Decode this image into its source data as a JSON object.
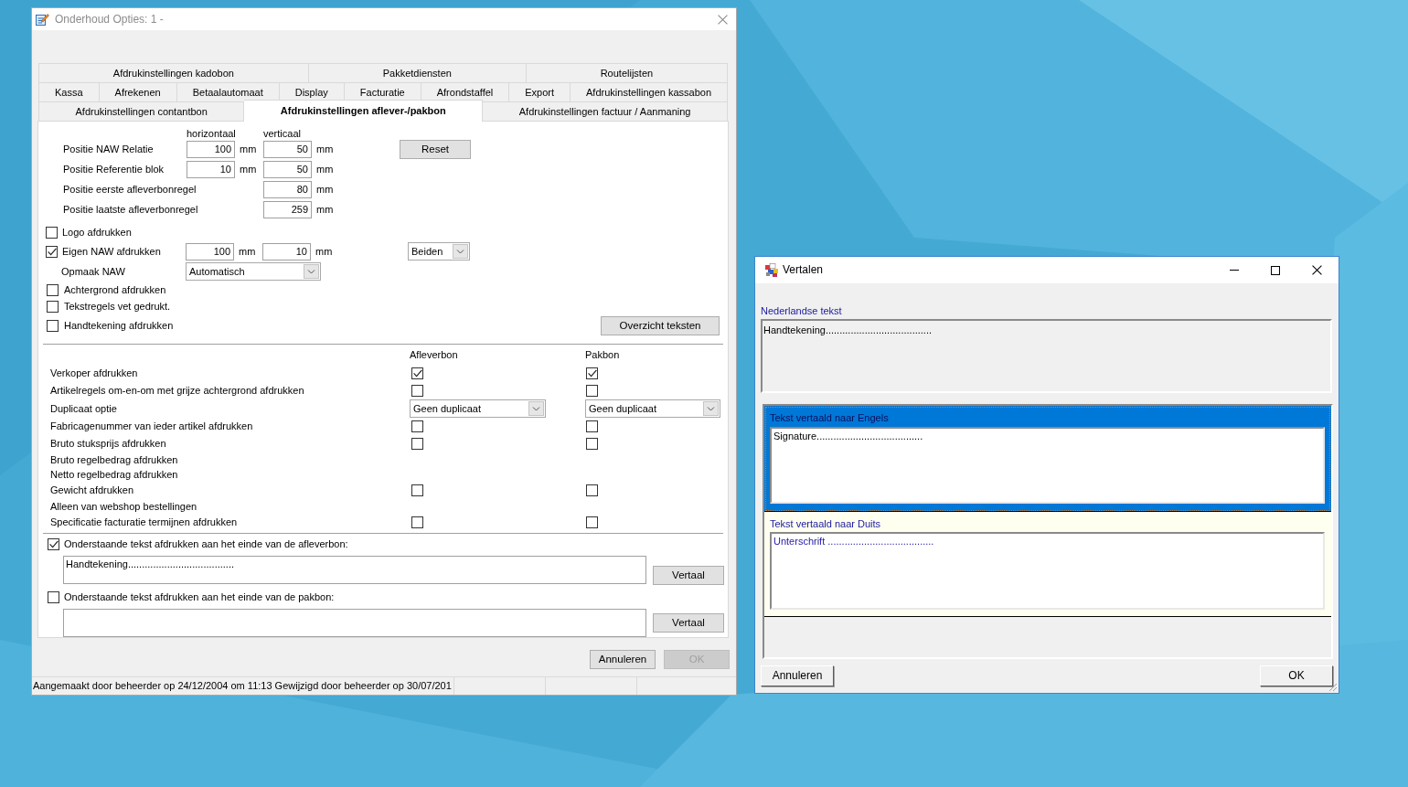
{
  "main_window": {
    "title": "Onderhoud Opties: 1 -",
    "active": false,
    "tab_rows": [
      [
        {
          "label": "Afdrukinstellingen kadobon",
          "selected": false
        },
        {
          "label": "Pakketdiensten",
          "selected": false
        },
        {
          "label": "Routelijsten",
          "selected": false
        }
      ],
      [
        {
          "label": "Kassa",
          "selected": false
        },
        {
          "label": "Afrekenen",
          "selected": false
        },
        {
          "label": "Betaalautomaat",
          "selected": false
        },
        {
          "label": "Display",
          "selected": false
        },
        {
          "label": "Facturatie",
          "selected": false
        },
        {
          "label": "Afrondstaffel",
          "selected": false
        },
        {
          "label": "Export",
          "selected": false
        },
        {
          "label": "Afdrukinstellingen kassabon",
          "selected": false
        }
      ],
      [
        {
          "label": "Afdrukinstellingen contantbon",
          "selected": false
        },
        {
          "label": "Afdrukinstellingen aflever-/pakbon",
          "selected": true
        },
        {
          "label": "Afdrukinstellingen factuur / Aanmaning",
          "selected": false
        }
      ]
    ],
    "position_headers": [
      "horizontaal",
      "verticaal"
    ],
    "position_rows": [
      {
        "label": "Positie NAW Relatie",
        "horizontal": {
          "value": "100",
          "unit": "mm"
        },
        "vertical": {
          "value": "50",
          "unit": "mm"
        }
      },
      {
        "label": "Positie Referentie blok",
        "horizontal": {
          "value": "10",
          "unit": "mm"
        },
        "vertical": {
          "value": "50",
          "unit": "mm"
        }
      },
      {
        "label": "Positie eerste afleverbonregel",
        "vertical": {
          "value": "80",
          "unit": "mm"
        }
      },
      {
        "label": "Positie laatste afleverbonregel",
        "vertical": {
          "value": "259",
          "unit": "mm"
        }
      }
    ],
    "reset_button": "Reset",
    "logo": {
      "label": "Logo afdrukken",
      "checked": false
    },
    "own_address": {
      "label": "Eigen NAW afdrukken",
      "checked": true,
      "horizontal": {
        "value": "100",
        "unit": "mm"
      },
      "vertical": {
        "value": "10",
        "unit": "mm"
      },
      "mode": "Beiden"
    },
    "address_layout": {
      "label": "Opmaak NAW",
      "value": "Automatisch"
    },
    "print_options": [
      {
        "label": "Achtergrond afdrukken",
        "checked": false
      },
      {
        "label": "Tekstregels vet gedrukt.",
        "checked": false
      },
      {
        "label": "Handtekening afdrukken",
        "checked": false
      }
    ],
    "overview_button": "Overzicht teksten",
    "document_options": {
      "columns": [
        "Afleverbon",
        "Pakbon"
      ],
      "rows": [
        {
          "label": "Verkoper afdrukken",
          "kind": "checkbox",
          "values": [
            {
              "checked": true
            },
            {
              "checked": true
            }
          ]
        },
        {
          "label": "Artikelregels om-en-om met grijze achtergrond afdrukken",
          "kind": "checkbox",
          "values": [
            {
              "checked": false
            },
            {
              "checked": false
            }
          ]
        },
        {
          "label": "Duplicaat optie",
          "kind": "select",
          "values": [
            {
              "value": "Geen duplicaat"
            },
            {
              "value": "Geen duplicaat"
            }
          ]
        },
        {
          "label": "Fabricagenummer van ieder artikel afdrukken",
          "kind": "checkbox",
          "values": [
            {
              "checked": false
            },
            {
              "checked": false
            }
          ]
        },
        {
          "label": "Bruto stuksprijs afdrukken",
          "kind": "checkbox",
          "values": [
            {
              "checked": false
            },
            {
              "checked": false
            }
          ]
        },
        {
          "label": "Bruto regelbedrag afdrukken",
          "kind": "text"
        },
        {
          "label": "Netto regelbedrag afdrukken",
          "kind": "text"
        },
        {
          "label": "Gewicht afdrukken",
          "kind": "checkbox",
          "values": [
            {
              "checked": false
            },
            {
              "checked": false
            }
          ]
        },
        {
          "label": "Alleen van webshop bestellingen",
          "kind": "text"
        },
        {
          "label": "Specificatie facturatie termijnen afdrukken",
          "kind": "checkbox",
          "values": [
            {
              "checked": false
            },
            {
              "checked": false
            }
          ]
        }
      ]
    },
    "closing_texts": [
      {
        "label": "Onderstaande tekst afdrukken aan het einde van de afleverbon:",
        "checked": true,
        "value": "Handtekening......................................",
        "button": "Vertaal"
      },
      {
        "label": "Onderstaande tekst afdrukken aan het einde van de pakbon:",
        "checked": false,
        "button": "Vertaal"
      }
    ],
    "buttons": [
      {
        "label": "Annuleren",
        "disabled": false
      },
      {
        "label": "OK",
        "disabled": true
      }
    ],
    "status_bar": {
      "text": "Aangemaakt door beheerder op 24/12/2004 om 11:13 Gewijzigd door beheerder op 30/07/201"
    }
  },
  "translate_dialog": {
    "title": "Vertalen",
    "active": true,
    "source": {
      "label": "Nederlandse tekst",
      "value": "Handtekening......................................"
    },
    "translations": [
      {
        "label": "Tekst vertaald naar Engels",
        "value": "Signature......................................",
        "selected": true
      },
      {
        "label": "Tekst vertaald naar Duits",
        "value": "Unterschrift ......................................",
        "selected": false
      }
    ],
    "buttons": [
      {
        "label": "Annuleren"
      },
      {
        "label": "OK"
      }
    ]
  }
}
